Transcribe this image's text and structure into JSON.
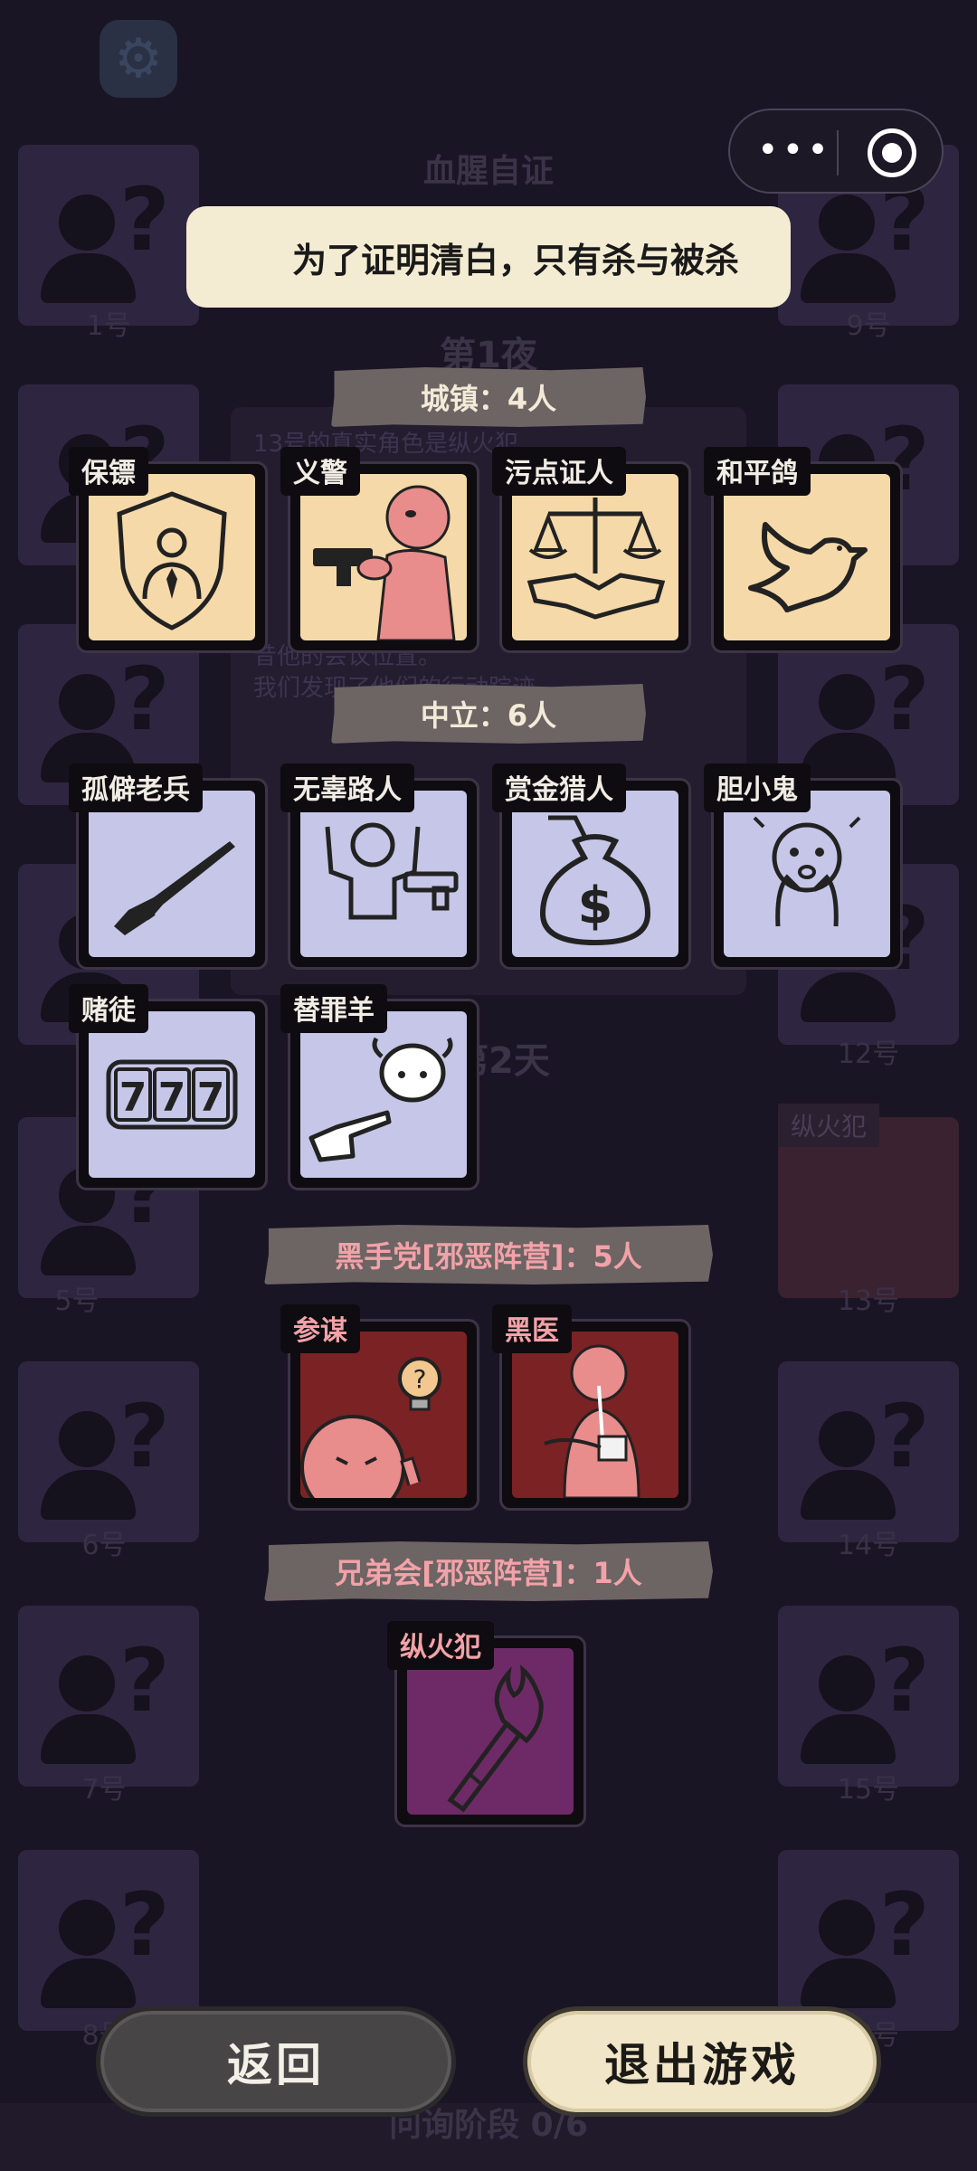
{
  "background": {
    "game_title": "血腥自证",
    "night_label": "第1夜",
    "day_label": "第2天",
    "phase_label": "问询阶段 0/6",
    "seat_numbers": [
      "1号",
      "9号",
      "5号",
      "13号",
      "6号",
      "14号",
      "7号",
      "15号",
      "8号",
      "16号",
      "12号"
    ],
    "arson_card_label": "纵火犯",
    "log_lines": [
      "13号的真实角色是纵火犯",
      "昔他的会议位置。",
      "我们发现了他们的行动踪迹"
    ]
  },
  "capsule": {
    "more_icon": "more-dots-icon",
    "close_icon": "target-circle-icon"
  },
  "tagline": "为了证明清白，只有杀与被杀",
  "sections": {
    "town": "城镇：4人",
    "neutral": "中立：6人",
    "mafia": "黑手党[邪恶阵营]：5人",
    "brotherhood": "兄弟会[邪恶阵营]：1人"
  },
  "roles": {
    "town": [
      {
        "name": "保镖",
        "icon": "shield-person-icon"
      },
      {
        "name": "义警",
        "icon": "gunman-icon"
      },
      {
        "name": "污点证人",
        "icon": "scales-handshake-icon"
      },
      {
        "name": "和平鸽",
        "icon": "dove-icon"
      }
    ],
    "neutral": [
      {
        "name": "孤僻老兵",
        "icon": "rifle-icon"
      },
      {
        "name": "无辜路人",
        "icon": "hands-up-icon"
      },
      {
        "name": "赏金猎人",
        "icon": "money-bag-icon"
      },
      {
        "name": "胆小鬼",
        "icon": "scared-face-icon"
      },
      {
        "name": "赌徒",
        "icon": "slot-777-icon"
      },
      {
        "name": "替罪羊",
        "icon": "pointing-sheep-icon"
      }
    ],
    "mafia": [
      {
        "name": "参谋",
        "icon": "idea-bulb-icon"
      },
      {
        "name": "黑医",
        "icon": "doctor-bandage-icon"
      }
    ],
    "brotherhood": [
      {
        "name": "纵火犯",
        "icon": "torch-icon"
      }
    ]
  },
  "buttons": {
    "back": "返回",
    "exit": "退出游戏"
  },
  "colors": {
    "town_bg": "#f5d9a8",
    "neutral_bg": "#c6c6e8",
    "mafia_bg": "#7a2224",
    "brotherhood_bg": "#6e2a66",
    "evil_text": "#f2a2a8"
  }
}
